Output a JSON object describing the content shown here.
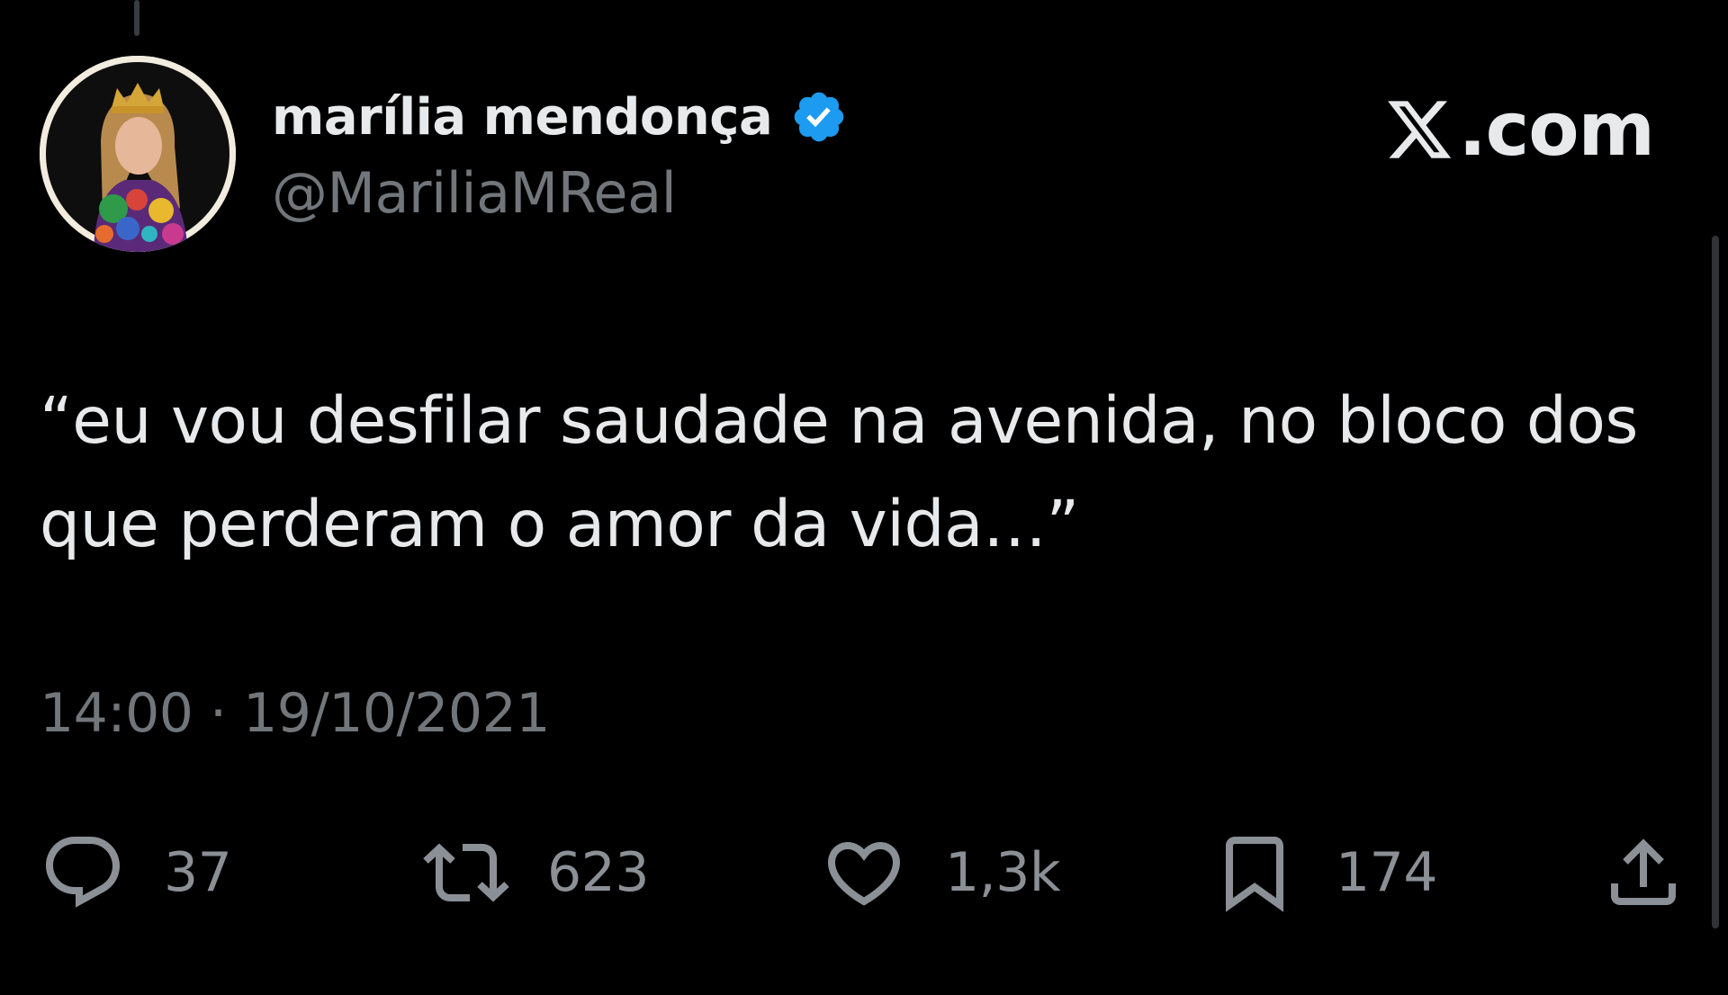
{
  "user": {
    "display_name": "marília mendonça",
    "handle": "@MariliaMReal",
    "verified": true,
    "avatar_icon": "profile-photo"
  },
  "brand": {
    "text": ".com",
    "icon": "x-logo"
  },
  "tweet": {
    "text": "“eu vou desfilar saudade na avenida, no bloco dos que perderam o amor da vida…”",
    "timestamp": "14:00 · 19/10/2021"
  },
  "actions": {
    "reply": {
      "icon": "reply-icon",
      "count": "37"
    },
    "repost": {
      "icon": "repost-icon",
      "count": "623"
    },
    "like": {
      "icon": "heart-icon",
      "count": "1,3k"
    },
    "bookmark": {
      "icon": "bookmark-icon",
      "count": "174"
    },
    "share": {
      "icon": "share-icon"
    }
  },
  "colors": {
    "background": "#000000",
    "primary_text": "#e7e9ea",
    "secondary_text": "#71767b",
    "verified_blue": "#1d9bf0"
  }
}
